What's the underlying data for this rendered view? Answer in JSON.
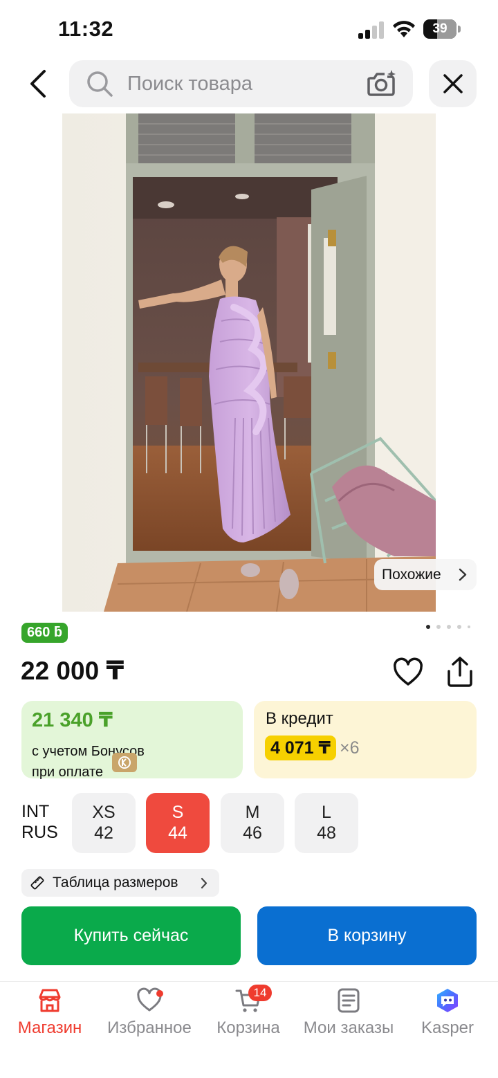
{
  "status_bar": {
    "time": "11:32",
    "battery": "39",
    "icons": [
      "signal-icon",
      "wifi-icon",
      "battery-icon"
    ]
  },
  "header": {
    "back_icon": "chevron-left-icon",
    "search_placeholder": "Поиск товара",
    "search_value": "",
    "camera_icon": "camera-search-icon",
    "close_icon": "close-icon"
  },
  "gallery": {
    "image_alt": "product-photo",
    "similar_label": "Похожие",
    "pages": 5,
    "active_page": 1
  },
  "product": {
    "bonus_badge": "660 ƃ",
    "price": "22 000 ₸",
    "favorite_icon": "heart-icon",
    "share_icon": "share-icon"
  },
  "offers": {
    "bonus_price": "21 340 ₸",
    "bonus_line1": "с учетом Бонусов",
    "bonus_line2": "при оплате",
    "credit_title": "В кредит",
    "credit_amount": "4 071 ₸",
    "credit_times": "×6"
  },
  "sizes": {
    "label_int": "INT",
    "label_rus": "RUS",
    "options": [
      {
        "int": "XS",
        "rus": "42",
        "selected": false
      },
      {
        "int": "S",
        "rus": "44",
        "selected": true
      },
      {
        "int": "M",
        "rus": "46",
        "selected": false
      },
      {
        "int": "L",
        "rus": "48",
        "selected": false
      }
    ],
    "size_table_label": "Таблица размеров"
  },
  "actions": {
    "buy_now": "Купить сейчас",
    "add_to_cart": "В корзину"
  },
  "bottom_nav": {
    "items": [
      {
        "label": "Магазин",
        "icon": "store-icon",
        "active": true
      },
      {
        "label": "Избранное",
        "icon": "heart-icon",
        "active": false
      },
      {
        "label": "Корзина",
        "icon": "cart-icon",
        "active": false
      },
      {
        "label": "Мои заказы",
        "icon": "orders-icon",
        "active": false
      },
      {
        "label": "Kasper",
        "icon": "kasper-assistant-icon",
        "active": false
      }
    ],
    "cart_badge": "14"
  },
  "colors": {
    "accent_red": "#ef3b2e",
    "buy_green": "#0aaa4b",
    "cart_blue": "#0a6fd1",
    "bonus_green": "#36a52b",
    "credit_yellow": "#f6d000"
  }
}
